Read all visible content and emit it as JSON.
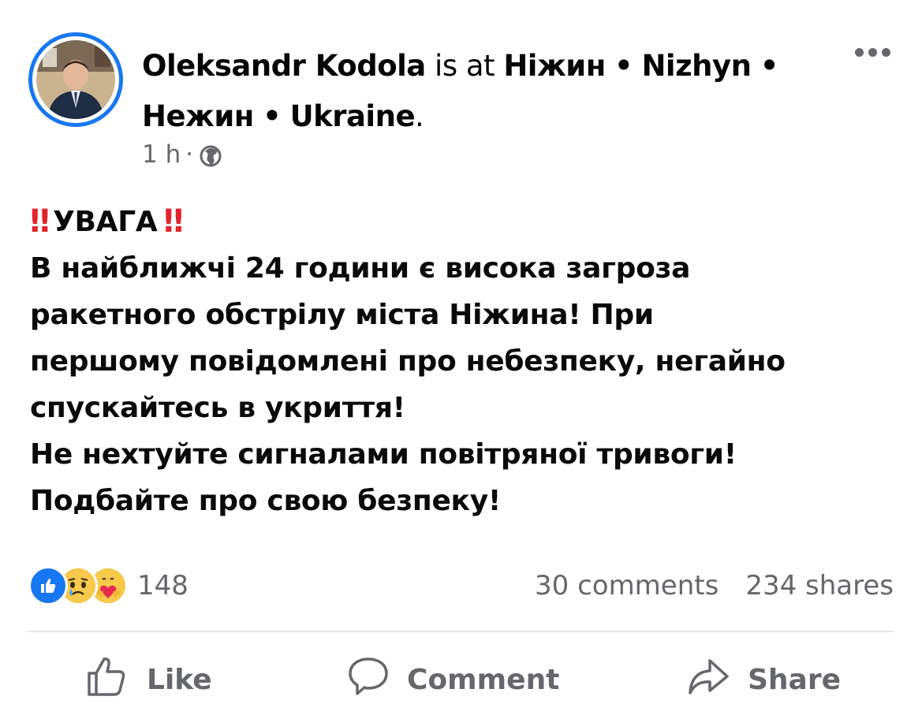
{
  "post": {
    "author": "Oleksandr Kodola",
    "is_at": "is at",
    "location_1": "Ніжин",
    "location_2": "Nizhyn",
    "location_3": "Нежин",
    "location_4": "Ukraine",
    "separator": "•",
    "end_period": ".",
    "time": "1 h",
    "time_dot": "·",
    "privacy_icon": "globe-icon",
    "more_icon": "more-options-icon"
  },
  "body": {
    "alert_marks": "‼",
    "alert_word": "УВАГА",
    "lines": [
      "В найближчі 24 години є висока загроза",
      "ракетного обстрілу міста Ніжина! При",
      "першому повідомлені про небезпеку, негайно",
      "спускайтесь в укриття!",
      "Не нехтуйте сигналами повітряної тривоги!",
      "Подбайте про свою безпеку!"
    ]
  },
  "stats": {
    "reaction_icons": [
      "like-reaction-icon",
      "sad-reaction-icon",
      "care-reaction-icon"
    ],
    "reaction_count": "148",
    "comments": "30 comments",
    "shares": "234 shares"
  },
  "actions": {
    "like_label": "Like",
    "comment_label": "Comment",
    "share_label": "Share"
  },
  "colors": {
    "accent": "#1877f2",
    "alert_red": "#e0242d",
    "muted_text": "#65676b"
  }
}
